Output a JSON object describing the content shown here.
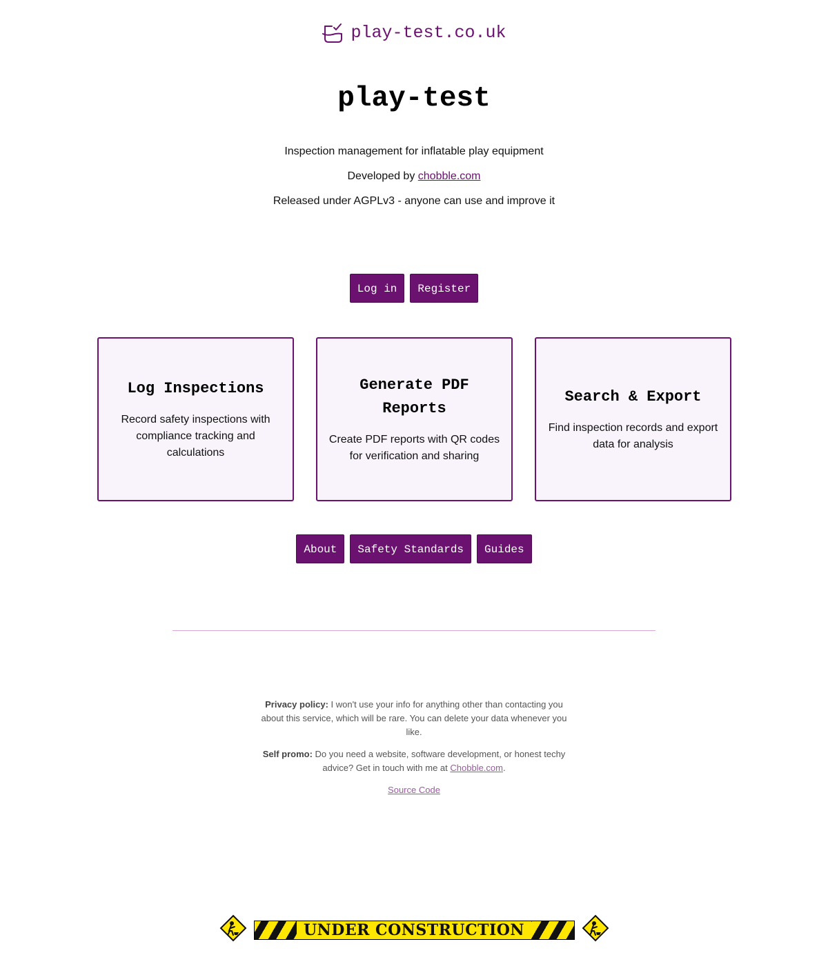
{
  "header": {
    "site_name": "play-test.co.uk",
    "logo_icon": "clipboard-check-icon",
    "accent": "#6b1170"
  },
  "page": {
    "title": "play-test",
    "tagline": "Inspection management for inflatable play equipment",
    "developed_by_prefix": "Developed by ",
    "developed_by_link": "chobble.com",
    "license": "Released under AGPLv3 - anyone can use and improve it"
  },
  "auth": {
    "login_label": "Log in",
    "register_label": "Register"
  },
  "features": [
    {
      "title": "Log Inspections",
      "description": "Record safety inspections with compliance tracking and calculations"
    },
    {
      "title": "Generate PDF Reports",
      "description": "Create PDF reports with QR codes for verification and sharing"
    },
    {
      "title": "Search & Export",
      "description": "Find inspection records and export data for analysis"
    }
  ],
  "nav": {
    "about": "About",
    "safety_standards": "Safety Standards",
    "guides": "Guides"
  },
  "footer": {
    "privacy_label": "Privacy policy:",
    "privacy_text": " I won't use your info for anything other than contacting you about this service, which will be rare. You can delete your data whenever you like.",
    "promo_label": "Self promo:",
    "promo_text": " Do you need a website, software development, or honest techy advice? Get in touch with me at ",
    "promo_link": "Chobble.com",
    "promo_end": ".",
    "source_code": "Source Code"
  },
  "construction": {
    "banner_text": "UNDER CONSTRUCTION",
    "sign_icon": "construction-worker-sign-icon"
  }
}
